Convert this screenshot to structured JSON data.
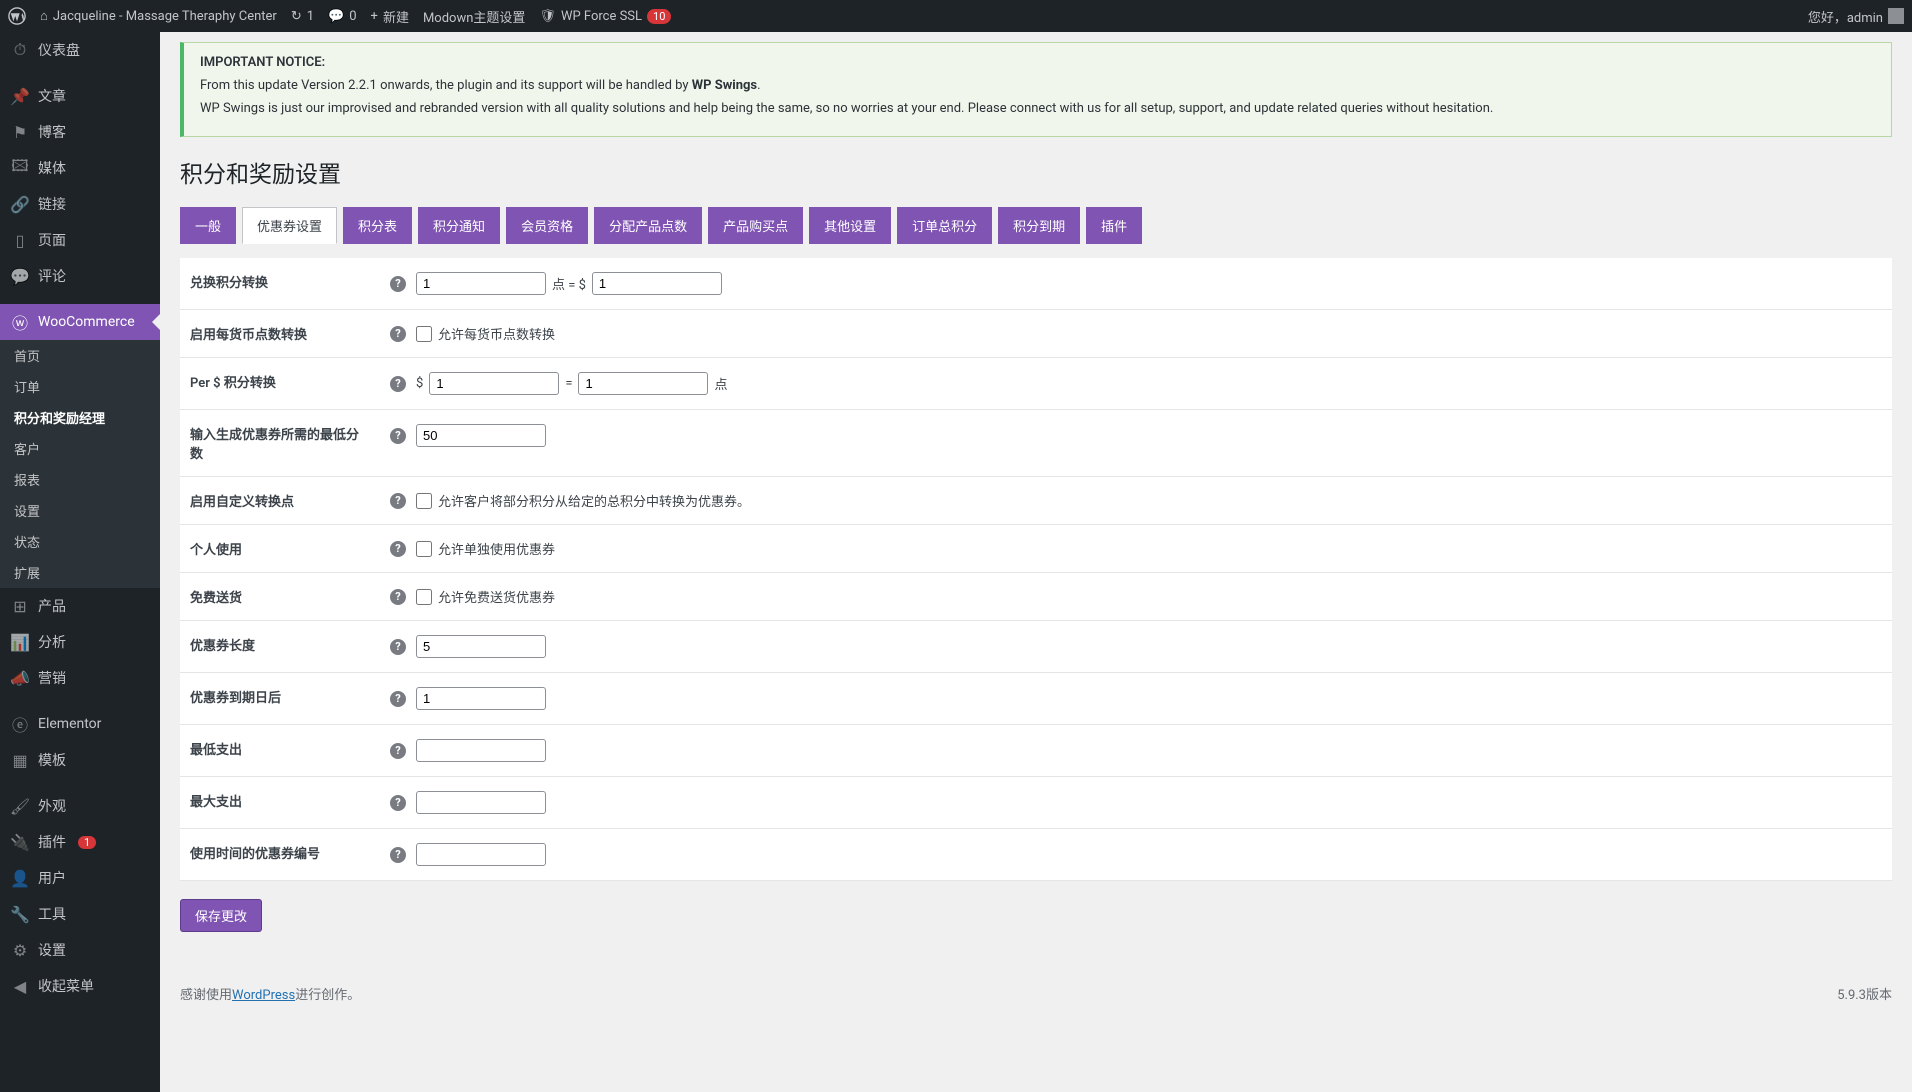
{
  "adminbar": {
    "site_name": "Jacqueline - Massage Theraphy Center",
    "updates": "1",
    "comments": "0",
    "new": "新建",
    "modown": "Modown主题设置",
    "wpforcessl": "WP Force SSL",
    "ssl_count": "10",
    "greeting": "您好，admin"
  },
  "sidebar": {
    "dashboard": "仪表盘",
    "posts": "文章",
    "blog": "博客",
    "media": "媒体",
    "links": "链接",
    "pages": "页面",
    "comments": "评论",
    "woocommerce": "WooCommerce",
    "woo_sub": {
      "home": "首页",
      "orders": "订单",
      "points": "积分和奖励经理",
      "customers": "客户",
      "reports": "报表",
      "settings": "设置",
      "status": "状态",
      "extensions": "扩展"
    },
    "products": "产品",
    "analytics": "分析",
    "marketing": "营销",
    "elementor": "Elementor",
    "templates": "模板",
    "appearance": "外观",
    "plugins": "插件",
    "plugins_count": "1",
    "users": "用户",
    "tools": "工具",
    "settings_main": "设置",
    "collapse": "收起菜单"
  },
  "notice": {
    "title": "IMPORTANT NOTICE:",
    "line1a": "From this update Version 2.2.1 onwards, the plugin and its support will be handled by ",
    "line1b": "WP Swings",
    "line1c": ".",
    "line2": "WP Swings is just our improvised and rebranded version with all quality solutions and help being the same, so no worries at your end. Please connect with us for all setup, support, and update related queries without hesitation."
  },
  "page_title": "积分和奖励设置",
  "tabs": [
    "一般",
    "优惠券设置",
    "积分表",
    "积分通知",
    "会员资格",
    "分配产品点数",
    "产品购买点",
    "其他设置",
    "订单总积分",
    "积分到期",
    "插件"
  ],
  "active_tab_index": 1,
  "form": {
    "rows": [
      {
        "label": "兑换积分转换",
        "type": "conversion",
        "v1": "1",
        "mid": "点 = $",
        "v2": "1"
      },
      {
        "label": "启用每货币点数转换",
        "type": "checkbox",
        "cbtext": "允许每货币点数转换"
      },
      {
        "label": "Per $ 积分转换",
        "type": "percurrency",
        "prefix": "$",
        "v1": "1",
        "mid": "=",
        "v2": "1",
        "suffix": "点"
      },
      {
        "label": "输入生成优惠券所需的最低分数",
        "type": "number",
        "value": "50"
      },
      {
        "label": "启用自定义转换点",
        "type": "checkbox",
        "cbtext": "允许客户将部分积分从给定的总积分中转换为优惠券。"
      },
      {
        "label": "个人使用",
        "type": "checkbox",
        "cbtext": "允许单独使用优惠券"
      },
      {
        "label": "免费送货",
        "type": "checkbox",
        "cbtext": "允许免费送货优惠券"
      },
      {
        "label": "优惠券长度",
        "type": "number",
        "value": "5"
      },
      {
        "label": "优惠券到期日后",
        "type": "number",
        "value": "1"
      },
      {
        "label": "最低支出",
        "type": "number",
        "value": ""
      },
      {
        "label": "最大支出",
        "type": "number",
        "value": ""
      },
      {
        "label": "使用时间的优惠券编号",
        "type": "number",
        "value": ""
      }
    ],
    "save": "保存更改"
  },
  "footer": {
    "thanks_a": "感谢使用",
    "thanks_link": "WordPress",
    "thanks_b": "进行创作。",
    "version": "5.9.3版本"
  }
}
